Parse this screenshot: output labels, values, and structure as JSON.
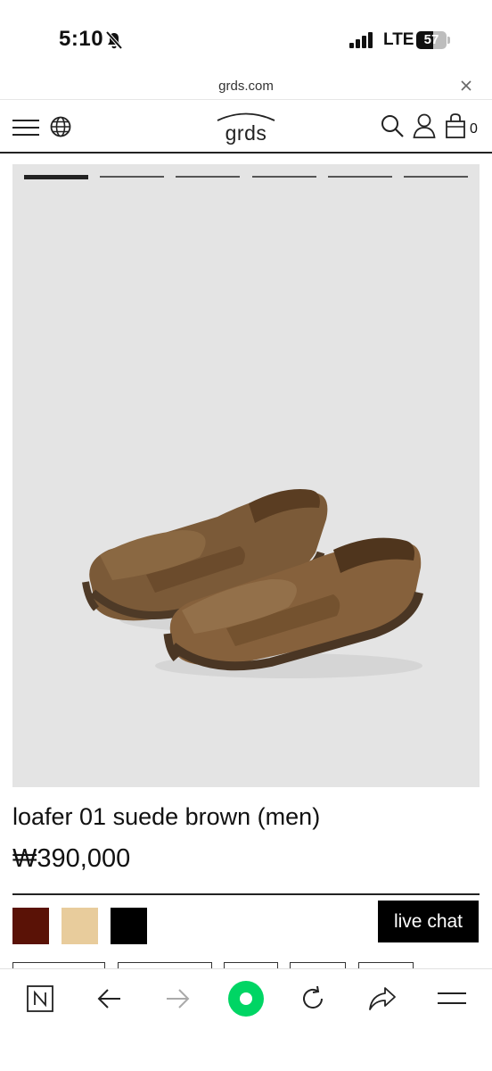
{
  "status_bar": {
    "time": "5:10",
    "network": "LTE",
    "battery_level": "57",
    "battery_fraction": 0.57,
    "icons": [
      "bell-slash-icon",
      "signal-icon",
      "battery-icon"
    ]
  },
  "url_bar": {
    "url": "grds.com",
    "close_icon": "close-icon"
  },
  "header": {
    "logo": "grds",
    "cart_count": "0",
    "icons": [
      "menu-icon",
      "globe-icon",
      "search-icon",
      "user-icon",
      "cart-icon"
    ]
  },
  "gallery": {
    "image_count": 6,
    "active_index": 0,
    "background": "#e4e4e4"
  },
  "product": {
    "name": "loafer 01 suede brown (men)",
    "price": "₩390,000",
    "colors": [
      "#5a1206",
      "#e8cc9c",
      "#000000"
    ]
  },
  "live_chat": {
    "label": "live chat"
  },
  "toolbar": {
    "icons": [
      "n-icon",
      "back-arrow-icon",
      "forward-arrow-icon",
      "green-home-icon",
      "reload-icon",
      "share-icon",
      "more-menu-icon"
    ],
    "accent": "#00d564"
  }
}
